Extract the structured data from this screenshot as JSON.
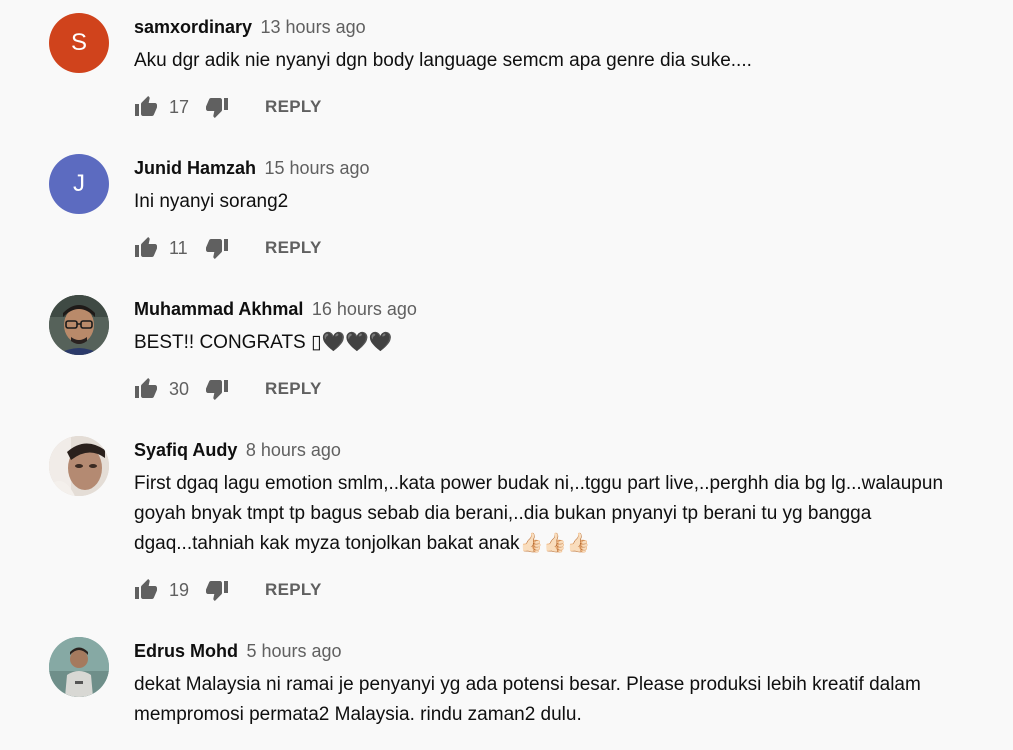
{
  "comments": [
    {
      "author": "samxordinary",
      "time": "13 hours ago",
      "text": "Aku dgr adik nie nyanyi dgn body language semcm apa genre dia suke....",
      "likes": "17",
      "reply_label": "REPLY",
      "avatar": {
        "type": "letter",
        "letter": "S",
        "color": "#d0431c"
      }
    },
    {
      "author": "Junid Hamzah",
      "time": "15 hours ago",
      "text": "Ini nyanyi sorang2",
      "likes": "11",
      "reply_label": "REPLY",
      "avatar": {
        "type": "letter",
        "letter": "J",
        "color": "#5c6bc0"
      }
    },
    {
      "author": "Muhammad Akhmal",
      "time": "16 hours ago",
      "text": "BEST!! CONGRATS ▯🖤🖤🖤",
      "likes": "30",
      "reply_label": "REPLY",
      "avatar": {
        "type": "photo"
      }
    },
    {
      "author": "Syafiq Audy",
      "time": "8 hours ago",
      "text": "First dgaq lagu emotion smlm,..kata power budak ni,..tggu part live,..perghh dia bg lg...walaupun goyah bnyak tmpt tp bagus sebab dia berani,..dia bukan pnyanyi tp berani tu yg bangga dgaq...tahniah kak myza tonjolkan bakat anak👍🏻👍🏻👍🏻",
      "likes": "19",
      "reply_label": "REPLY",
      "avatar": {
        "type": "photo"
      }
    },
    {
      "author": "Edrus Mohd",
      "time": "5 hours ago",
      "text": "dekat Malaysia ni ramai je penyanyi yg ada potensi besar. Please produksi lebih kreatif dalam mempromosi permata2 Malaysia. rindu zaman2 dulu.",
      "avatar": {
        "type": "photo"
      }
    }
  ],
  "colors": {
    "icon": "#606060",
    "secondary_text": "#606060",
    "primary_text": "#0f0f0f",
    "background": "#f9f9f9"
  },
  "icons": {
    "like": "thumb-up-icon",
    "dislike": "thumb-down-icon"
  }
}
